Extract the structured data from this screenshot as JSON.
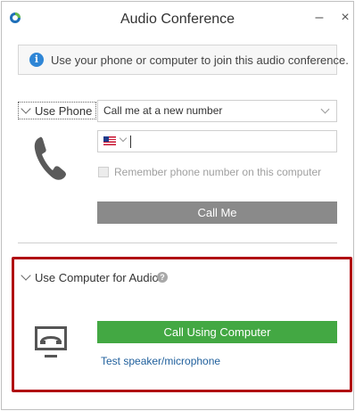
{
  "window": {
    "title": "Audio Conference",
    "minimize_glyph": "–",
    "close_glyph": "×"
  },
  "info_banner": {
    "icon": "info-icon",
    "text": "Use your phone or computer to join this audio conference."
  },
  "phone_section": {
    "toggle_label": "Use Phone",
    "number_select": "Call me at a new number",
    "phone_number_value": "",
    "remember_label": "Remember phone number on this computer",
    "call_button": "Call Me"
  },
  "computer_section": {
    "toggle_label": "Use Computer for Audio",
    "help_glyph": "?",
    "call_button": "Call Using Computer",
    "test_link": "Test speaker/microphone"
  },
  "colors": {
    "info_blue": "#2f86d6",
    "call_me_gray": "#8a8a8a",
    "call_computer_green": "#43a843",
    "highlight_red": "#b00a12",
    "link_blue": "#1f5f9c"
  }
}
